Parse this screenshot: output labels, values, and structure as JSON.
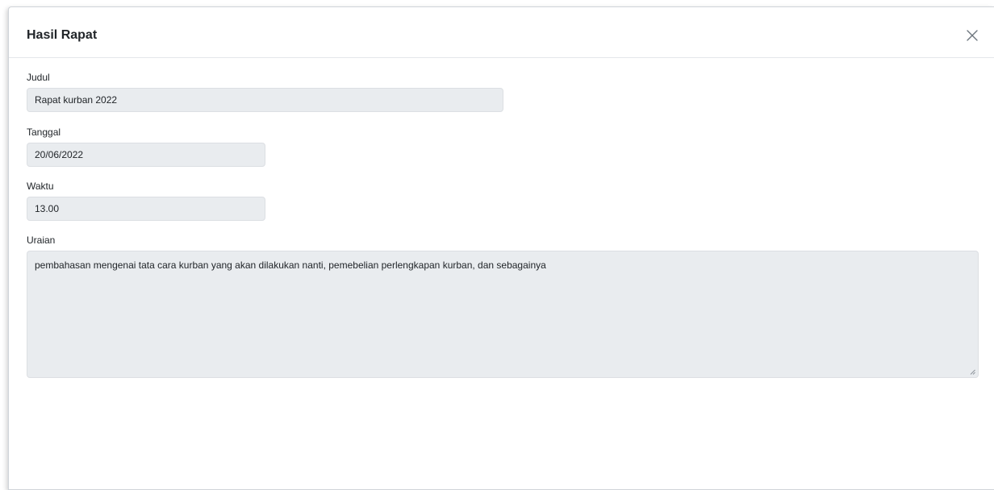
{
  "modal": {
    "title": "Hasil Rapat",
    "close_icon": "close-icon"
  },
  "form": {
    "judul": {
      "label": "Judul",
      "value": "Rapat kurban 2022"
    },
    "tanggal": {
      "label": "Tanggal",
      "value": "20/06/2022"
    },
    "waktu": {
      "label": "Waktu",
      "value": "13.00"
    },
    "uraian": {
      "label": "Uraian",
      "value": "pembahasan mengenai tata cara kurban yang akan dilakukan nanti, pemebelian perlengkapan kurban, dan sebagainya"
    }
  }
}
